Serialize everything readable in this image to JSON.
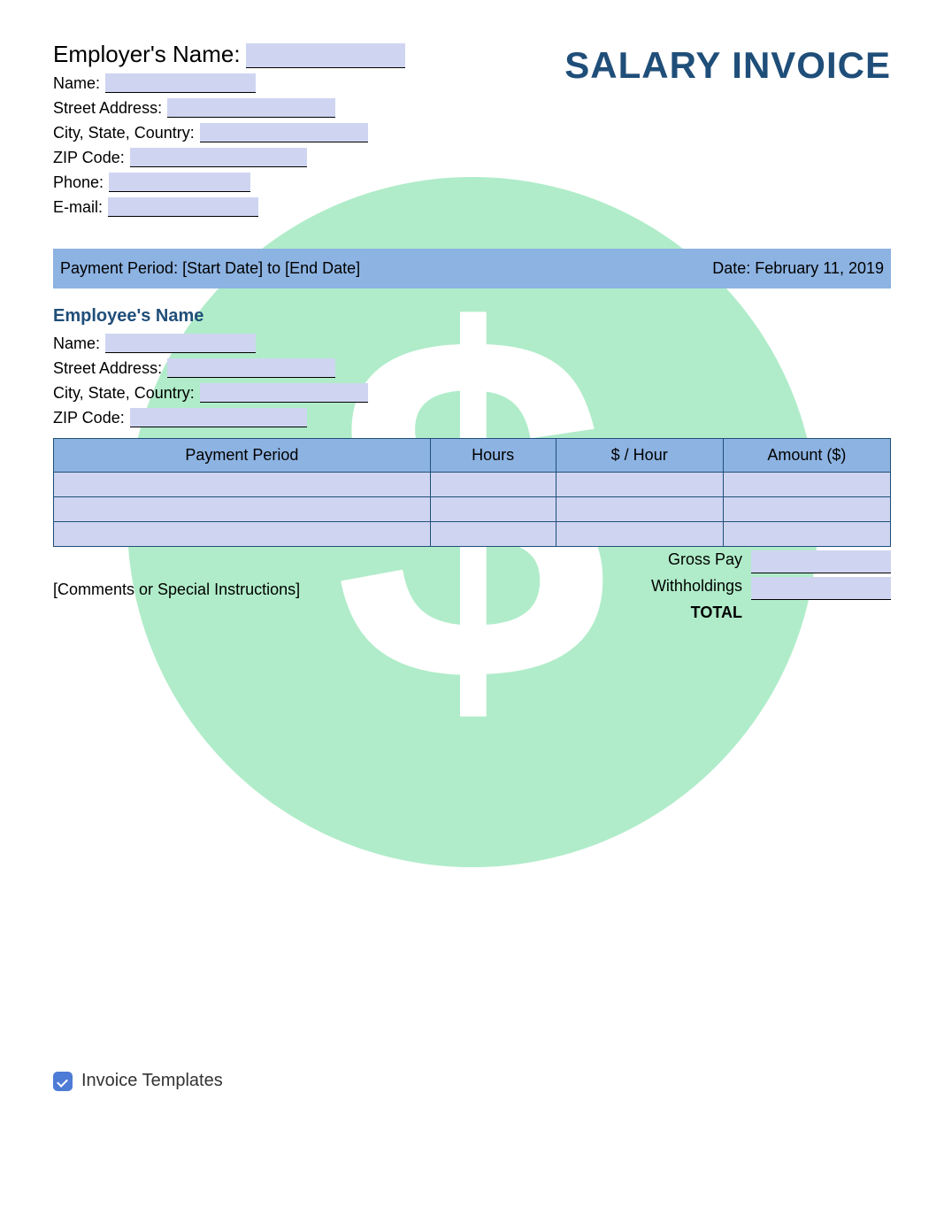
{
  "title": "SALARY INVOICE",
  "employer": {
    "heading_label": "Employer's Name:",
    "name_label": "Name:",
    "street_label": "Street Address:",
    "city_label": "City, State, Country:",
    "zip_label": "ZIP Code:",
    "phone_label": "Phone:",
    "email_label": "E-mail:"
  },
  "payment_bar": {
    "period": "Payment Period: [Start Date] to [End Date]",
    "date": "Date: February 11, 2019"
  },
  "employee": {
    "heading": "Employee's Name",
    "name_label": "Name:",
    "street_label": "Street Address:",
    "city_label": "City, State, Country:",
    "zip_label": "ZIP Code:"
  },
  "table": {
    "headers": [
      "Payment Period",
      "Hours",
      "$ / Hour",
      "Amount ($)"
    ]
  },
  "totals": {
    "gross": "Gross Pay",
    "withholdings": "Withholdings",
    "total": "TOTAL"
  },
  "comments_placeholder": "[Comments or Special Instructions]",
  "footer": "Invoice Templates"
}
